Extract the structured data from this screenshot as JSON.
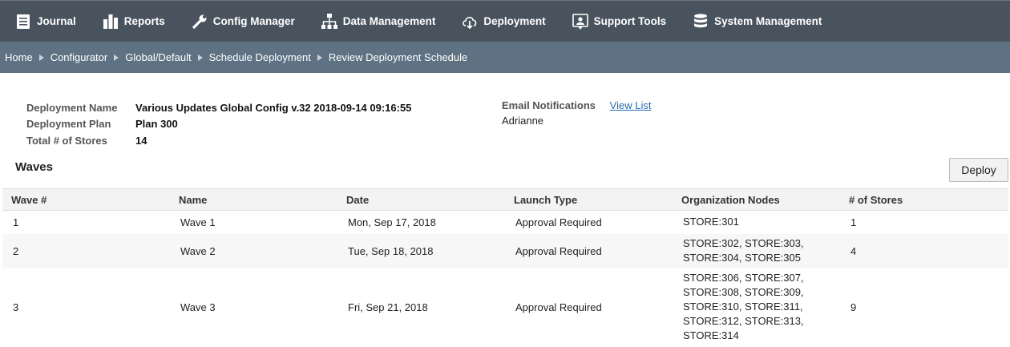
{
  "nav": {
    "items": [
      {
        "label": "Journal",
        "icon": "journal-icon"
      },
      {
        "label": "Reports",
        "icon": "bar-chart-icon"
      },
      {
        "label": "Config Manager",
        "icon": "wrench-icon"
      },
      {
        "label": "Data Management",
        "icon": "hierarchy-icon"
      },
      {
        "label": "Deployment",
        "icon": "cloud-download-icon"
      },
      {
        "label": "Support Tools",
        "icon": "support-icon"
      },
      {
        "label": "System Management",
        "icon": "database-icon"
      }
    ]
  },
  "breadcrumb": [
    "Home",
    "Configurator",
    "Global/Default",
    "Schedule Deployment",
    "Review Deployment Schedule"
  ],
  "summary": {
    "deployment_name_label": "Deployment Name",
    "deployment_name": "Various Updates Global Config v.32 2018-09-14 09:16:55",
    "deployment_plan_label": "Deployment Plan",
    "deployment_plan": "Plan 300",
    "total_stores_label": "Total # of Stores",
    "total_stores": "14"
  },
  "email": {
    "label": "Email Notifications",
    "link": "View List",
    "recipient": "Adrianne"
  },
  "waves": {
    "title": "Waves",
    "deploy_label": "Deploy",
    "columns": [
      "Wave #",
      "Name",
      "Date",
      "Launch Type",
      "Organization Nodes",
      "# of Stores"
    ],
    "rows": [
      {
        "num": "1",
        "name": "Wave 1",
        "date": "Mon, Sep 17, 2018",
        "launch": "Approval Required",
        "nodes": [
          "STORE:301"
        ],
        "stores": "1"
      },
      {
        "num": "2",
        "name": "Wave 2",
        "date": "Tue, Sep 18, 2018",
        "launch": "Approval Required",
        "nodes": [
          "STORE:302, STORE:303,",
          "STORE:304, STORE:305"
        ],
        "stores": "4"
      },
      {
        "num": "3",
        "name": "Wave 3",
        "date": "Fri, Sep 21, 2018",
        "launch": "Approval Required",
        "nodes": [
          "STORE:306, STORE:307,",
          "STORE:308, STORE:309,",
          "STORE:310, STORE:311,",
          "STORE:312, STORE:313,",
          "STORE:314"
        ],
        "stores": "9"
      }
    ]
  }
}
